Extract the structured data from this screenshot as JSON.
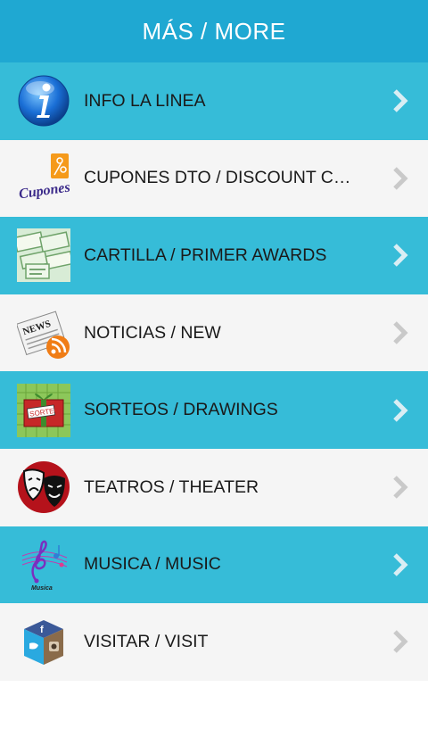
{
  "header": {
    "title": "MÁS / MORE"
  },
  "menu": {
    "items": [
      {
        "label": "INFO LA LINEA",
        "icon": "info-icon",
        "style": "blue"
      },
      {
        "label": "CUPONES DTO / DISCOUNT COU…",
        "icon": "cupones-icon",
        "style": "white",
        "icon_text": "Cupones"
      },
      {
        "label": "CARTILLA / PRIMER AWARDS",
        "icon": "coupon-tickets-icon",
        "style": "blue"
      },
      {
        "label": "NOTICIAS / NEW",
        "icon": "news-rss-icon",
        "style": "white",
        "icon_text": "NEWS"
      },
      {
        "label": "SORTEOS / DRAWINGS",
        "icon": "gift-box-icon",
        "style": "blue",
        "icon_text": "SORTEO"
      },
      {
        "label": "TEATROS / THEATER",
        "icon": "theater-masks-icon",
        "style": "white"
      },
      {
        "label": "MUSICA / MUSIC",
        "icon": "music-clef-icon",
        "style": "blue",
        "icon_text": "Musica"
      },
      {
        "label": "VISITAR / VISIT",
        "icon": "social-cube-icon",
        "style": "white"
      }
    ]
  },
  "colors": {
    "header": "#1fa8d2",
    "row_blue": "#36bcd8",
    "row_white": "#f5f5f5",
    "text": "#1a1a1a"
  }
}
